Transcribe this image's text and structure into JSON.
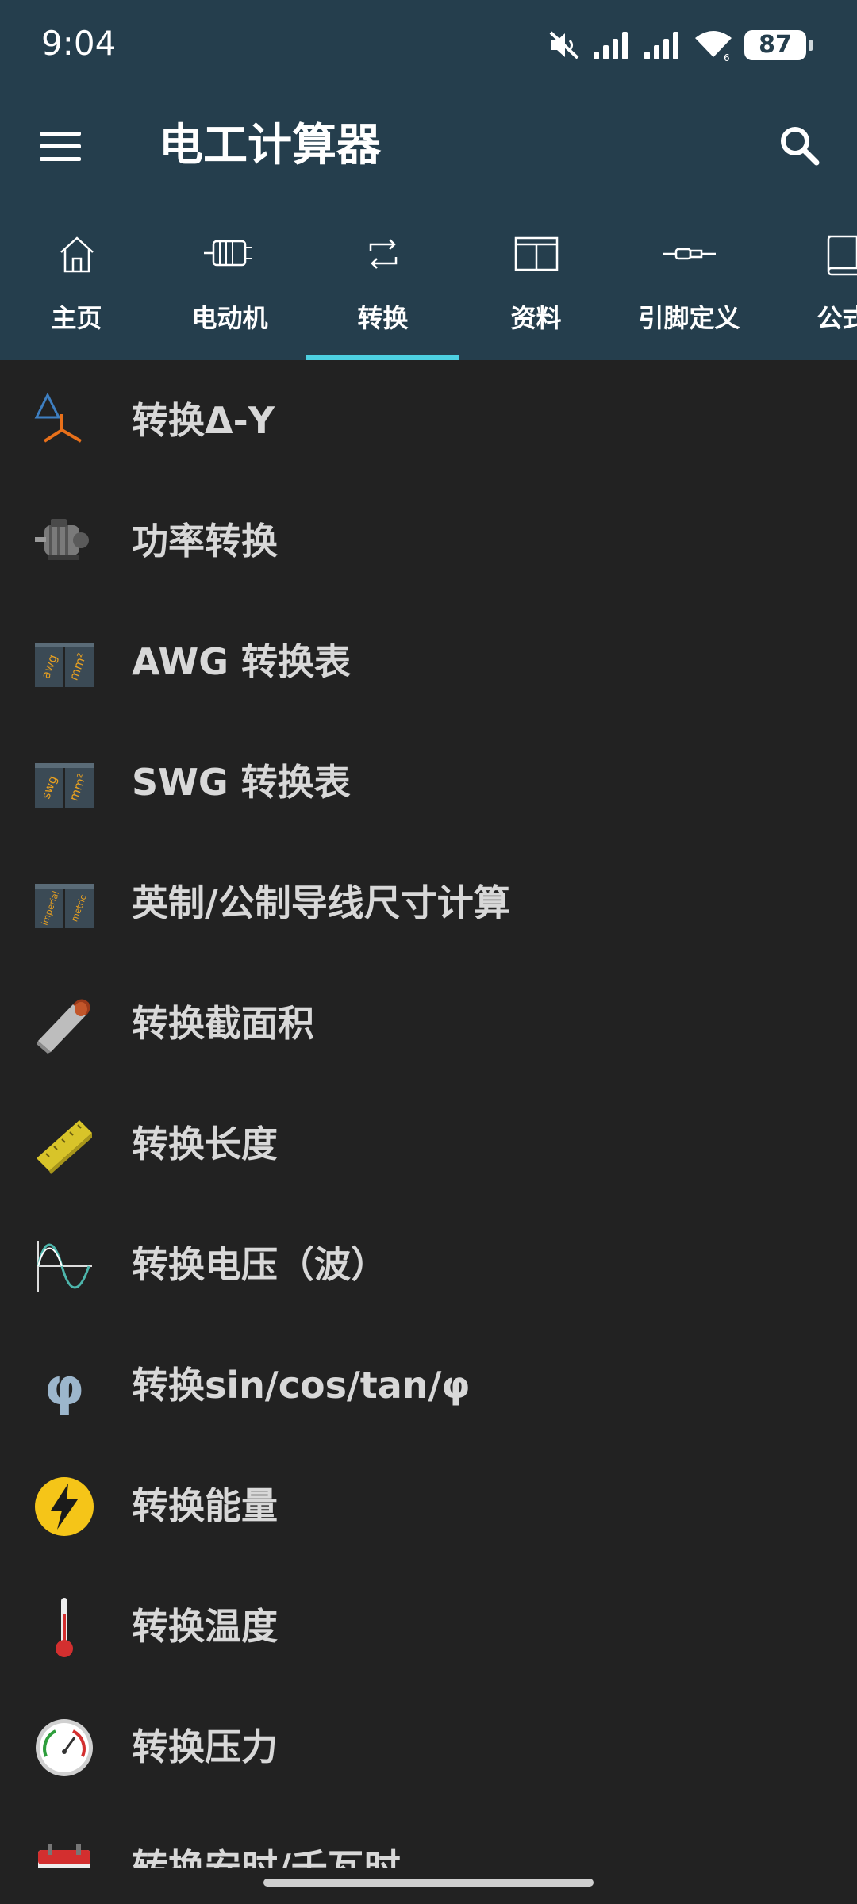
{
  "status": {
    "time": "9:04",
    "battery": "87"
  },
  "app": {
    "title": "电工计算器"
  },
  "tabs": [
    {
      "label": "主页",
      "icon": "home-icon"
    },
    {
      "label": "电动机",
      "icon": "motor-icon"
    },
    {
      "label": "转换",
      "icon": "convert-icon",
      "selected": true
    },
    {
      "label": "资料",
      "icon": "table-icon"
    },
    {
      "label": "引脚定义",
      "icon": "connector-icon"
    },
    {
      "label": "公式",
      "icon": "book-icon"
    }
  ],
  "items": [
    {
      "label": "转换Δ-Y",
      "icon": "delta-wye-icon"
    },
    {
      "label": "功率转换",
      "icon": "motor-photo-icon"
    },
    {
      "label": "AWG 转换表",
      "icon": "awg-mm2-icon",
      "icon_text": [
        "awg",
        "mm²"
      ]
    },
    {
      "label": "SWG 转换表",
      "icon": "swg-mm2-icon",
      "icon_text": [
        "swg",
        "mm²"
      ]
    },
    {
      "label": "英制/公制导线尺寸计算",
      "icon": "imperial-metric-icon",
      "icon_text": [
        "imperial",
        "metric"
      ]
    },
    {
      "label": "转换截面积",
      "icon": "cable-icon"
    },
    {
      "label": "转换长度",
      "icon": "ruler-icon"
    },
    {
      "label": "转换电压（波）",
      "icon": "sine-wave-icon"
    },
    {
      "label": "转换sin/cos/tan/φ",
      "icon": "phi-icon",
      "icon_text": [
        "φ"
      ]
    },
    {
      "label": "转换能量",
      "icon": "lightning-icon"
    },
    {
      "label": "转换温度",
      "icon": "thermometer-icon"
    },
    {
      "label": "转换压力",
      "icon": "gauge-icon"
    },
    {
      "label": "转换安时/千瓦时",
      "icon": "calendar-icon"
    }
  ],
  "colors": {
    "appbar": "#253E4D",
    "background": "#222222",
    "indicator": "#4DD0E1",
    "text": "#d8d8d8"
  }
}
